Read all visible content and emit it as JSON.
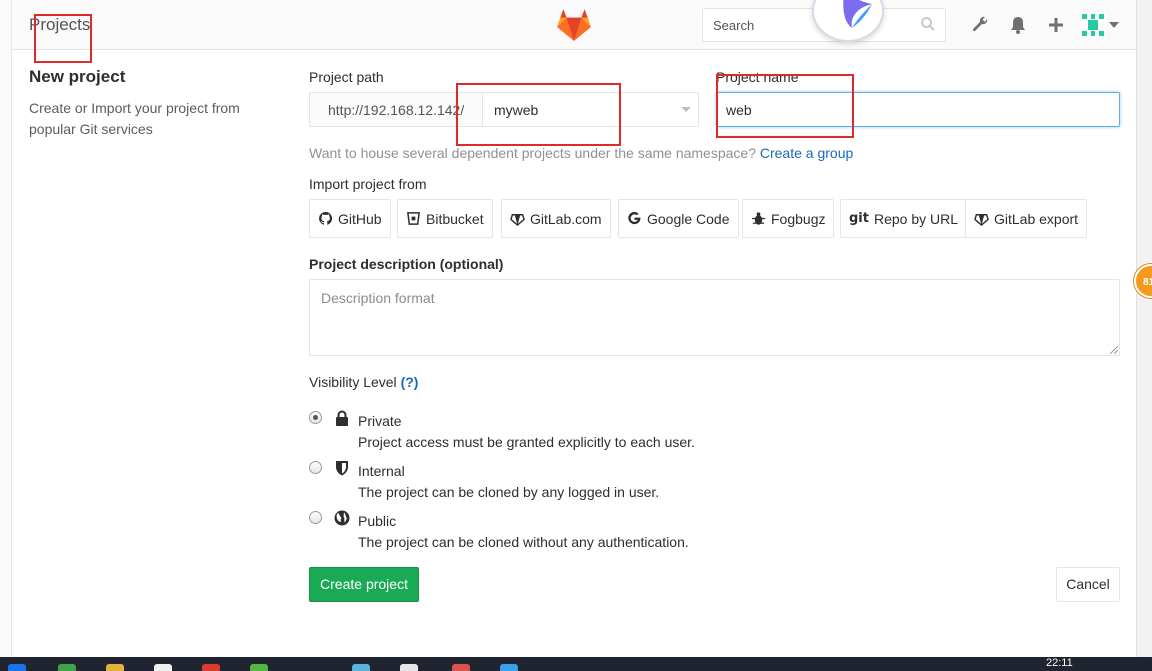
{
  "header": {
    "breadcrumb": "Projects",
    "search_placeholder": "Search"
  },
  "sidebar": {
    "title": "New project",
    "description": "Create or Import your project from popular Git services"
  },
  "form": {
    "path_label": "Project path",
    "path_prefix": "http://192.168.12.142/",
    "namespace": "myweb",
    "name_label": "Project name",
    "name_value": "web",
    "hint_text": "Want to house several dependent projects under the same namespace?",
    "hint_link": "Create a group",
    "import_label": "Import project from",
    "import_sources": [
      {
        "label": "GitHub",
        "icon": "github-icon"
      },
      {
        "label": "Bitbucket",
        "icon": "bitbucket-icon"
      },
      {
        "label": "GitLab.com",
        "icon": "gitlab-icon"
      },
      {
        "label": "Google Code",
        "icon": "google-icon"
      },
      {
        "label": "Fogbugz",
        "icon": "bug-icon"
      },
      {
        "label": "Repo by URL",
        "icon": "git-icon"
      },
      {
        "label": "GitLab export",
        "icon": "gitlab-icon"
      }
    ],
    "description_label": "Project description (optional)",
    "description_placeholder": "Description format",
    "visibility_label": "Visibility Level",
    "visibility_help": "(?)",
    "visibility_options": [
      {
        "title": "Private",
        "description": "Project access must be granted explicitly to each user.",
        "icon": "lock-icon",
        "selected": true
      },
      {
        "title": "Internal",
        "description": "The project can be cloned by any logged in user.",
        "icon": "shield-icon",
        "selected": false
      },
      {
        "title": "Public",
        "description": "The project can be cloned without any authentication.",
        "icon": "globe-icon",
        "selected": false
      }
    ],
    "create_button": "Create project",
    "cancel_button": "Cancel"
  },
  "floating_badge": "81",
  "taskbar": {
    "clock": "22:11"
  },
  "colors": {
    "brand_orange": "#fc6d26",
    "create_green": "#1aaa55",
    "link_blue": "#1b69b6",
    "annotation_red": "#e02929"
  }
}
